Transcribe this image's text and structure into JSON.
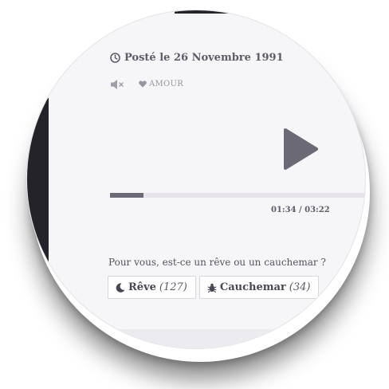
{
  "post": {
    "date_text": "Posté le 26 Novembre 1991"
  },
  "controls": {
    "mute_icon": "speaker-muted-icon",
    "love_label": "AMOUR"
  },
  "player": {
    "progress": 0.13,
    "time_text": "01:34 / 03:22"
  },
  "poll": {
    "question": "Pour vous, est-ce un rêve ou un cauchemar ?",
    "options": [
      {
        "icon": "moon-icon",
        "label": "Rêve",
        "count": "(127)"
      },
      {
        "icon": "bug-icon",
        "label": "Cauchemar",
        "count": "(34)"
      }
    ]
  },
  "colors": {
    "accent": "#6c6977",
    "dark_panel": "#24232a"
  }
}
